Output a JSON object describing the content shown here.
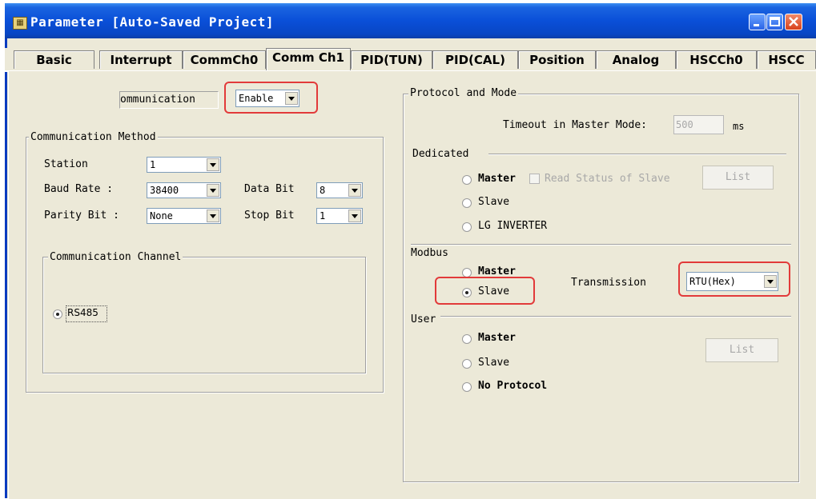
{
  "window": {
    "title": "Parameter [Auto-Saved Project]",
    "app_icon": "parameter-app-icon"
  },
  "tabs": [
    {
      "label": "Basic"
    },
    {
      "label": "Interrupt"
    },
    {
      "label": "CommCh0"
    },
    {
      "label": "Comm Ch1",
      "active": true
    },
    {
      "label": "PID(TUN)"
    },
    {
      "label": "PID(CAL)"
    },
    {
      "label": "Position"
    },
    {
      "label": "Analog"
    },
    {
      "label": "HSCCh0"
    },
    {
      "label": "HSCC"
    }
  ],
  "communication": {
    "label": "Communication",
    "label_visible": "ommunication",
    "value": "Enable"
  },
  "method": {
    "title": "Communication Method",
    "station_label": "Station",
    "station_value": "1",
    "baud_label": "Baud Rate :",
    "baud_value": "38400",
    "data_bit_label": "Data Bit",
    "data_bit_value": "8",
    "parity_label": "Parity Bit :",
    "parity_value": "None",
    "stop_bit_label": "Stop Bit",
    "stop_bit_value": "1"
  },
  "channel": {
    "title": "Communication Channel",
    "rs485_label": "RS485",
    "rs485_selected": true
  },
  "protocol": {
    "title": "Protocol and Mode",
    "timeout_label": "Timeout in Master Mode:",
    "timeout_value": "500",
    "timeout_unit": "ms",
    "dedicated": {
      "title": "Dedicated",
      "master_label": "Master",
      "read_status_label": "Read Status of Slave",
      "list_label": "List",
      "slave_label": "Slave",
      "lg_label": "LG INVERTER"
    },
    "modbus": {
      "title": "Modbus",
      "master_label": "Master",
      "slave_label": "Slave",
      "selected": "Slave",
      "transmission_label": "Transmission",
      "transmission_value": "RTU(Hex)"
    },
    "user": {
      "title": "User",
      "master_label": "Master",
      "slave_label": "Slave",
      "noproto_label": "No Protocol",
      "list_label": "List"
    }
  },
  "colors": {
    "highlight": "#e23a3a",
    "titlebar": "#0a4fd8",
    "dialog_bg": "#ece9d8"
  }
}
